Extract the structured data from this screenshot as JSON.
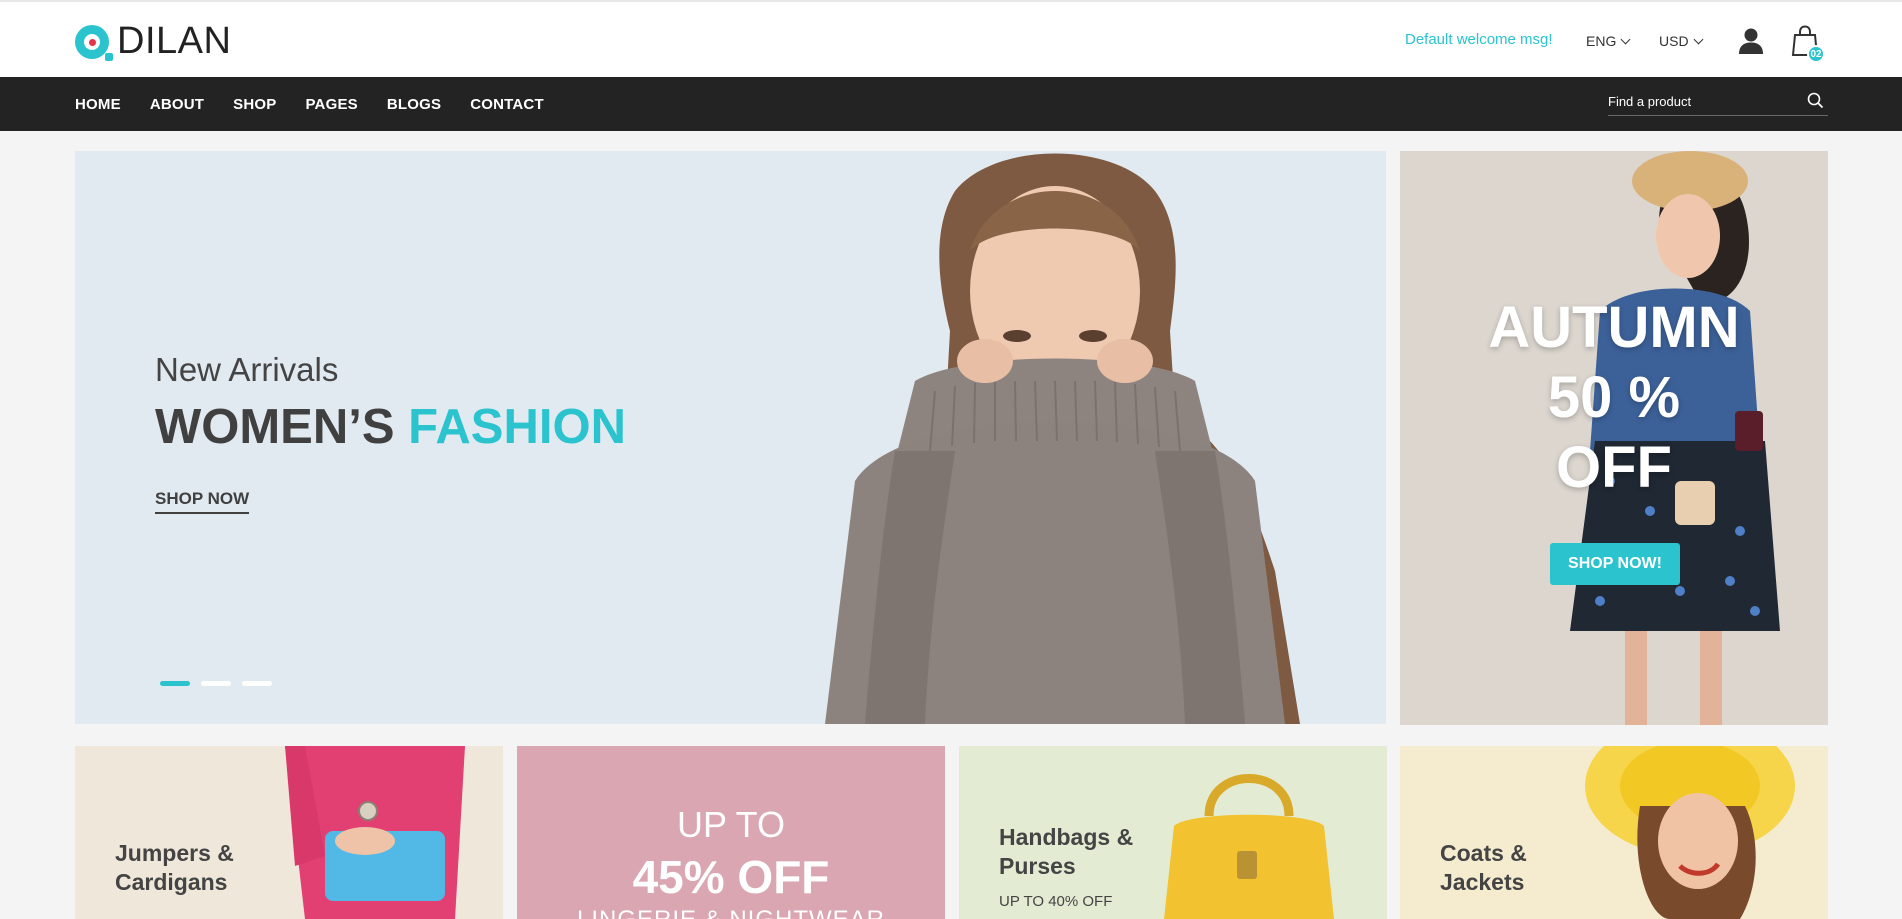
{
  "brand": {
    "name": "DILAN"
  },
  "header": {
    "welcome": "Default welcome msg!",
    "language": "ENG",
    "currency": "USD",
    "cart_count": "02"
  },
  "nav": {
    "items": [
      "HOME",
      "ABOUT",
      "SHOP",
      "PAGES",
      "BLOGS",
      "CONTACT"
    ],
    "search_placeholder": "Find a product"
  },
  "hero": {
    "subtitle": "New Arrivals",
    "title_dark": "WOMEN’S ",
    "title_accent": "FASHION",
    "cta": "SHOP NOW",
    "active_slide": 1,
    "slides": 3
  },
  "side_banner": {
    "line1": "AUTUMN",
    "line2": "50 %",
    "line3": "OFF",
    "cta": "SHOP NOW!"
  },
  "tiles": [
    {
      "title_line1": "Jumpers &",
      "title_line2": "Cardigans"
    },
    {
      "up_to": "UP TO",
      "off": "45% OFF",
      "category": "LINGERIE & NIGHTWEAR"
    },
    {
      "title_line1": "Handbags &",
      "title_line2": "Purses",
      "subtitle": "UP TO 40% OFF"
    },
    {
      "title_line1": "Coats &",
      "title_line2": "Jackets"
    }
  ],
  "colors": {
    "accent": "#2ac3ce",
    "nav_bg": "#232323",
    "hero_bg": "#e2eaf1"
  }
}
